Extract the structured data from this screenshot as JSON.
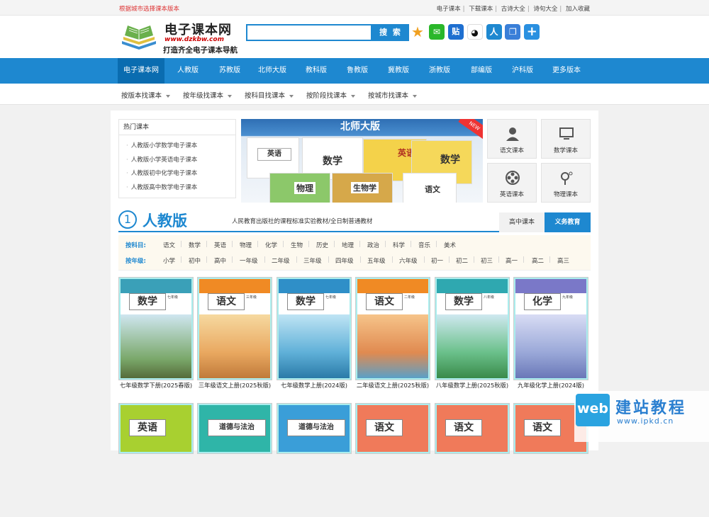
{
  "top": {
    "left": "根据城市选择课本版本",
    "links": [
      "电子课本",
      "下载课本",
      "古诗大全",
      "诗句大全",
      "加入收藏"
    ]
  },
  "logo": {
    "title": "电子课本网",
    "url": "www.dzkbw.com",
    "slogan": "打造齐全电子课本导航"
  },
  "search": {
    "placeholder": "",
    "button": "搜 索"
  },
  "share": [
    "star-icon",
    "wechat-icon",
    "tie-icon",
    "qq-icon",
    "renren-icon",
    "copy-icon",
    "plus-icon"
  ],
  "nav": [
    "电子课本网",
    "人教版",
    "苏教版",
    "北师大版",
    "教科版",
    "鲁教版",
    "冀教版",
    "浙教版",
    "部编版",
    "沪科版",
    "更多版本"
  ],
  "subnav": [
    "按版本找课本",
    "按年级找课本",
    "按科目找课本",
    "按阶段找课本",
    "按城市找课本"
  ],
  "hot": {
    "title": "热门课本",
    "items": [
      "人教版小学数学电子课本",
      "人教版小学英语电子课本",
      "人教版初中化学电子课本",
      "人教版高中数学电子课本"
    ]
  },
  "banner": {
    "title": "北师大版",
    "new": "NEW",
    "books": [
      "英语",
      "数学",
      "英语",
      "数学",
      "物理",
      "生物学",
      "语文"
    ]
  },
  "quick": [
    "语文课本",
    "数学课本",
    "英语课本",
    "物理课本"
  ],
  "section": {
    "num": "1",
    "name": "人教版",
    "desc": "人民教育出版社的课程标准实验教材/全日制普通教材",
    "tab1": "高中课本",
    "tab2": "义务教育"
  },
  "filter": {
    "subject_label": "按科目:",
    "subjects": [
      "语文",
      "数学",
      "英语",
      "物理",
      "化学",
      "生物",
      "历史",
      "地理",
      "政治",
      "科学",
      "音乐",
      "美术"
    ],
    "grade_label": "按年级:",
    "grades": [
      "小学",
      "初中",
      "高中",
      "一年级",
      "二年级",
      "三年级",
      "四年级",
      "五年级",
      "六年级",
      "初一",
      "初二",
      "初三",
      "高一",
      "高二",
      "高三"
    ]
  },
  "books": [
    {
      "title": "数学",
      "grade": "七年级",
      "caption": "七年级数学下册(2025春版)",
      "color": "#3aa0b8"
    },
    {
      "title": "语文",
      "grade": "三年级",
      "caption": "三年级语文上册(2025秋版)",
      "color": "#f08a24"
    },
    {
      "title": "数学",
      "grade": "七年级",
      "caption": "七年级数学上册(2024版)",
      "color": "#2f8fc8"
    },
    {
      "title": "语文",
      "grade": "二年级",
      "caption": "二年级语文上册(2025秋版)",
      "color": "#f08a24"
    },
    {
      "title": "数学",
      "grade": "八年级",
      "caption": "八年级数学上册(2025秋版)",
      "color": "#2fa8b0"
    },
    {
      "title": "化学",
      "grade": "九年级",
      "caption": "九年级化学上册(2024版)",
      "color": "#7a78c8"
    }
  ],
  "books2": [
    {
      "title": "英语",
      "color": "#a8d030"
    },
    {
      "title": "道德与法治",
      "color": "#2fb5a8"
    },
    {
      "title": "道德与法治",
      "color": "#3a9ed8"
    },
    {
      "title": "语文",
      "color": "#f07a5a"
    },
    {
      "title": "语文",
      "color": "#f07a5a"
    },
    {
      "title": "语文",
      "color": "#f07a5a"
    }
  ],
  "watermark": {
    "logo": "web",
    "name": "建站教程",
    "url": "www.ipkd.cn"
  }
}
